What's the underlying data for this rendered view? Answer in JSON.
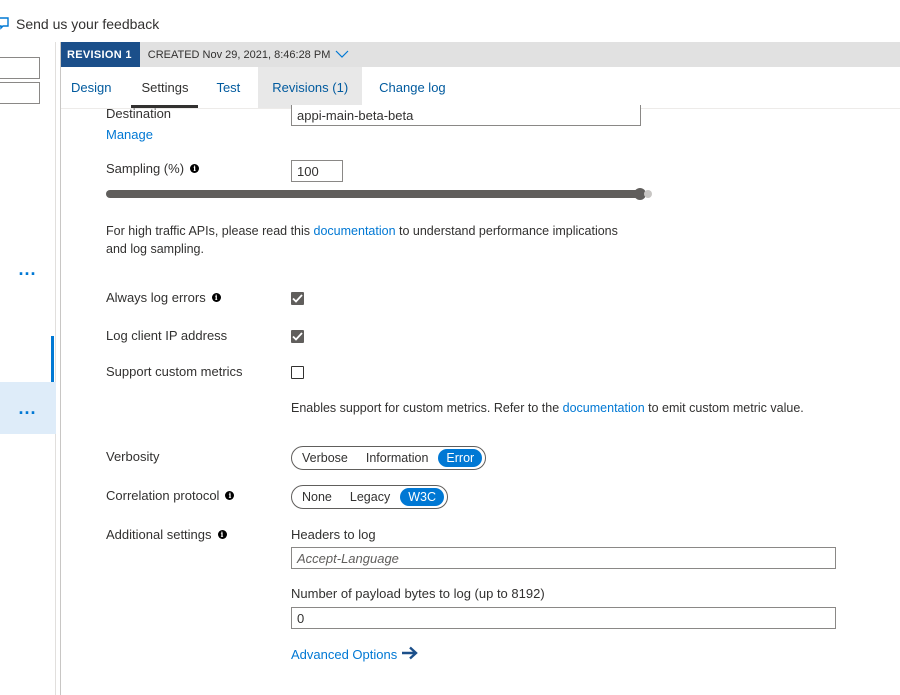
{
  "feedback": {
    "label": "Send us your feedback",
    "icon": "feedback-icon"
  },
  "left": {
    "ellipsis_1": "...",
    "ellipsis_2": "..."
  },
  "revision": {
    "badge": "REVISION 1",
    "created": "CREATED Nov 29, 2021, 8:46:28 PM",
    "dropdown_icon": "chevron-down-icon"
  },
  "tabs": [
    {
      "label": "Design"
    },
    {
      "label": "Settings"
    },
    {
      "label": "Test"
    },
    {
      "label": "Revisions (1)"
    },
    {
      "label": "Change log"
    }
  ],
  "destination": {
    "label": "Destination",
    "manage": "Manage",
    "value": "appi-main-beta-beta"
  },
  "sampling": {
    "label": "Sampling (%)",
    "value": "100",
    "level_percent": 100
  },
  "sampling_note": {
    "pre": "For high traffic APIs, please read this ",
    "link": "documentation",
    "post": " to understand performance implications",
    "line2": "and log sampling."
  },
  "always_log_errors": {
    "label": "Always log errors",
    "checked": true
  },
  "log_client_ip": {
    "label": "Log client IP address",
    "checked": true
  },
  "custom_metrics": {
    "label": "Support custom metrics",
    "checked": false,
    "note_pre": "Enables support for custom metrics. Refer to the ",
    "note_link": "documentation",
    "note_post": " to emit custom metric value."
  },
  "verbosity": {
    "label": "Verbosity",
    "options": [
      "Verbose",
      "Information",
      "Error"
    ],
    "selected": "Error"
  },
  "correlation": {
    "label": "Correlation protocol",
    "options": [
      "None",
      "Legacy",
      "W3C"
    ],
    "selected": "W3C"
  },
  "additional": {
    "label": "Additional settings",
    "headers_label": "Headers to log",
    "headers_placeholder": "Accept-Language",
    "payload_label": "Number of payload bytes to log (up to 8192)",
    "payload_value": "0",
    "advanced": "Advanced Options"
  },
  "colors": {
    "accent": "#0078d4",
    "badge": "#1b4f8a",
    "selected_left": "#deecf9"
  }
}
